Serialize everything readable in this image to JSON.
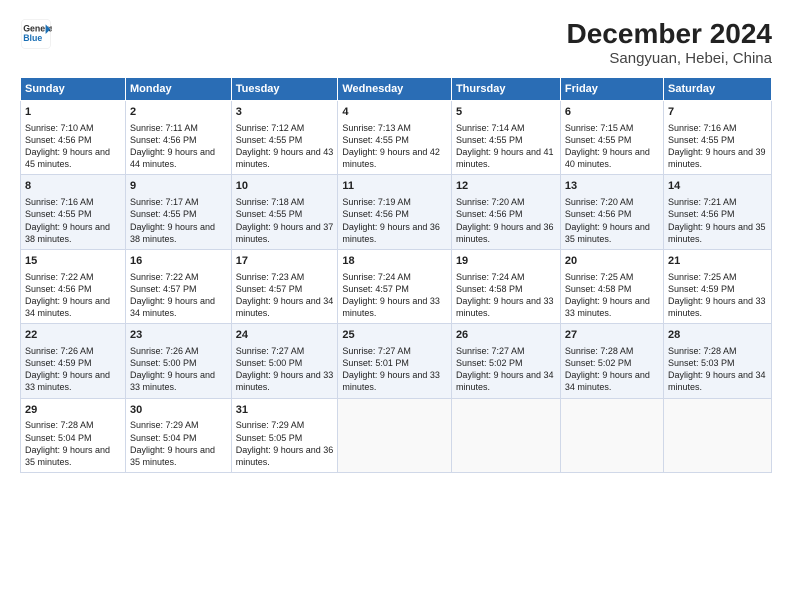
{
  "logo": {
    "line1": "General",
    "line2": "Blue"
  },
  "title": "December 2024",
  "subtitle": "Sangyuan, Hebei, China",
  "days_of_week": [
    "Sunday",
    "Monday",
    "Tuesday",
    "Wednesday",
    "Thursday",
    "Friday",
    "Saturday"
  ],
  "weeks": [
    [
      {
        "day": "1",
        "sunrise": "7:10 AM",
        "sunset": "4:56 PM",
        "daylight": "9 hours and 45 minutes."
      },
      {
        "day": "2",
        "sunrise": "7:11 AM",
        "sunset": "4:56 PM",
        "daylight": "9 hours and 44 minutes."
      },
      {
        "day": "3",
        "sunrise": "7:12 AM",
        "sunset": "4:55 PM",
        "daylight": "9 hours and 43 minutes."
      },
      {
        "day": "4",
        "sunrise": "7:13 AM",
        "sunset": "4:55 PM",
        "daylight": "9 hours and 42 minutes."
      },
      {
        "day": "5",
        "sunrise": "7:14 AM",
        "sunset": "4:55 PM",
        "daylight": "9 hours and 41 minutes."
      },
      {
        "day": "6",
        "sunrise": "7:15 AM",
        "sunset": "4:55 PM",
        "daylight": "9 hours and 40 minutes."
      },
      {
        "day": "7",
        "sunrise": "7:16 AM",
        "sunset": "4:55 PM",
        "daylight": "9 hours and 39 minutes."
      }
    ],
    [
      {
        "day": "8",
        "sunrise": "7:16 AM",
        "sunset": "4:55 PM",
        "daylight": "9 hours and 38 minutes."
      },
      {
        "day": "9",
        "sunrise": "7:17 AM",
        "sunset": "4:55 PM",
        "daylight": "9 hours and 38 minutes."
      },
      {
        "day": "10",
        "sunrise": "7:18 AM",
        "sunset": "4:55 PM",
        "daylight": "9 hours and 37 minutes."
      },
      {
        "day": "11",
        "sunrise": "7:19 AM",
        "sunset": "4:56 PM",
        "daylight": "9 hours and 36 minutes."
      },
      {
        "day": "12",
        "sunrise": "7:20 AM",
        "sunset": "4:56 PM",
        "daylight": "9 hours and 36 minutes."
      },
      {
        "day": "13",
        "sunrise": "7:20 AM",
        "sunset": "4:56 PM",
        "daylight": "9 hours and 35 minutes."
      },
      {
        "day": "14",
        "sunrise": "7:21 AM",
        "sunset": "4:56 PM",
        "daylight": "9 hours and 35 minutes."
      }
    ],
    [
      {
        "day": "15",
        "sunrise": "7:22 AM",
        "sunset": "4:56 PM",
        "daylight": "9 hours and 34 minutes."
      },
      {
        "day": "16",
        "sunrise": "7:22 AM",
        "sunset": "4:57 PM",
        "daylight": "9 hours and 34 minutes."
      },
      {
        "day": "17",
        "sunrise": "7:23 AM",
        "sunset": "4:57 PM",
        "daylight": "9 hours and 34 minutes."
      },
      {
        "day": "18",
        "sunrise": "7:24 AM",
        "sunset": "4:57 PM",
        "daylight": "9 hours and 33 minutes."
      },
      {
        "day": "19",
        "sunrise": "7:24 AM",
        "sunset": "4:58 PM",
        "daylight": "9 hours and 33 minutes."
      },
      {
        "day": "20",
        "sunrise": "7:25 AM",
        "sunset": "4:58 PM",
        "daylight": "9 hours and 33 minutes."
      },
      {
        "day": "21",
        "sunrise": "7:25 AM",
        "sunset": "4:59 PM",
        "daylight": "9 hours and 33 minutes."
      }
    ],
    [
      {
        "day": "22",
        "sunrise": "7:26 AM",
        "sunset": "4:59 PM",
        "daylight": "9 hours and 33 minutes."
      },
      {
        "day": "23",
        "sunrise": "7:26 AM",
        "sunset": "5:00 PM",
        "daylight": "9 hours and 33 minutes."
      },
      {
        "day": "24",
        "sunrise": "7:27 AM",
        "sunset": "5:00 PM",
        "daylight": "9 hours and 33 minutes."
      },
      {
        "day": "25",
        "sunrise": "7:27 AM",
        "sunset": "5:01 PM",
        "daylight": "9 hours and 33 minutes."
      },
      {
        "day": "26",
        "sunrise": "7:27 AM",
        "sunset": "5:02 PM",
        "daylight": "9 hours and 34 minutes."
      },
      {
        "day": "27",
        "sunrise": "7:28 AM",
        "sunset": "5:02 PM",
        "daylight": "9 hours and 34 minutes."
      },
      {
        "day": "28",
        "sunrise": "7:28 AM",
        "sunset": "5:03 PM",
        "daylight": "9 hours and 34 minutes."
      }
    ],
    [
      {
        "day": "29",
        "sunrise": "7:28 AM",
        "sunset": "5:04 PM",
        "daylight": "9 hours and 35 minutes."
      },
      {
        "day": "30",
        "sunrise": "7:29 AM",
        "sunset": "5:04 PM",
        "daylight": "9 hours and 35 minutes."
      },
      {
        "day": "31",
        "sunrise": "7:29 AM",
        "sunset": "5:05 PM",
        "daylight": "9 hours and 36 minutes."
      },
      null,
      null,
      null,
      null
    ]
  ],
  "labels": {
    "sunrise": "Sunrise:",
    "sunset": "Sunset:",
    "daylight": "Daylight:"
  }
}
